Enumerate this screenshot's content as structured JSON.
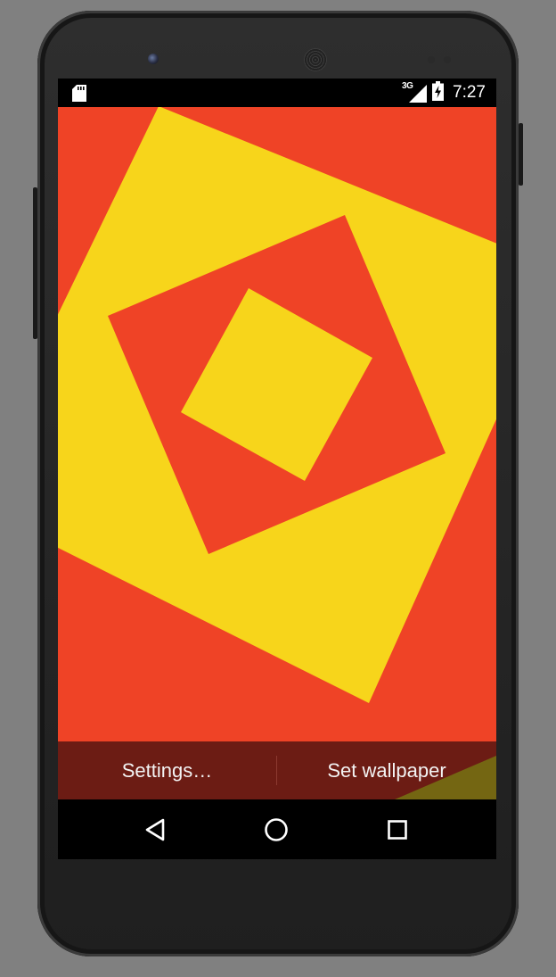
{
  "status_bar": {
    "sd_card_icon": "sd-card-icon",
    "network_type": "3G",
    "signal_icon": "signal-icon",
    "battery_icon": "battery-charging-icon",
    "time": "7:27"
  },
  "wallpaper": {
    "colors": {
      "red": "#ef4326",
      "yellow": "#f7d51b"
    }
  },
  "preview_actions": {
    "settings_label": "Settings…",
    "set_wallpaper_label": "Set wallpaper",
    "bar_color": "#6c1c14"
  },
  "nav_bar": {
    "back_icon": "back-triangle-icon",
    "home_icon": "home-circle-icon",
    "recents_icon": "recents-square-icon"
  }
}
